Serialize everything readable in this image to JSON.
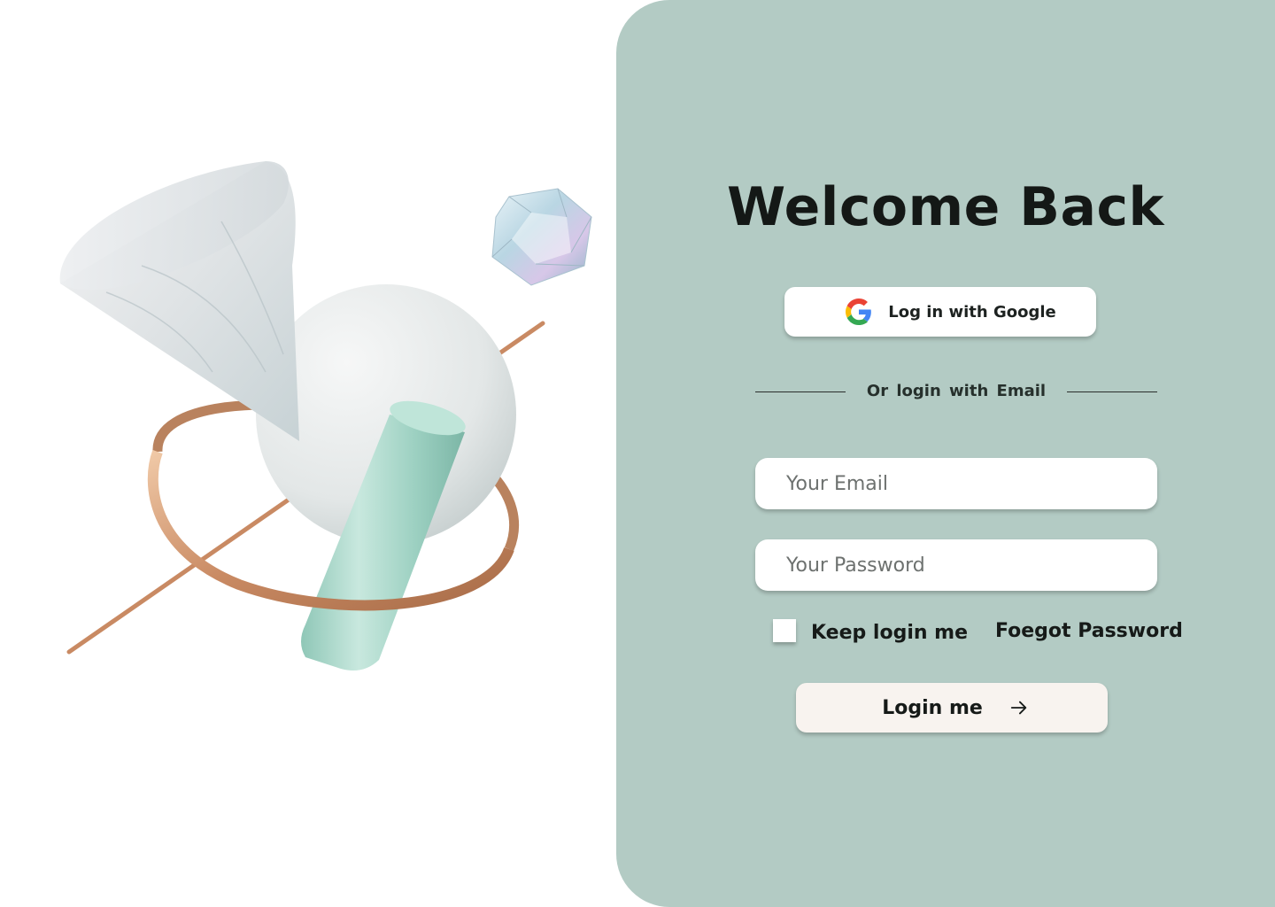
{
  "colors": {
    "panel_bg": "#b3cbc4",
    "primary_button_bg": "#f8f3ef",
    "text_dark": "#141816"
  },
  "art": {
    "shapes": [
      "marble-cone",
      "white-sphere",
      "crystal-gem",
      "copper-ring",
      "copper-rod",
      "mint-cylinder"
    ]
  },
  "login": {
    "title": "Welcome Back",
    "google_button": {
      "label": "Log in with Google",
      "icon": "google-icon"
    },
    "divider_text": "Or  login with  Email",
    "email_field": {
      "placeholder": "Your Email",
      "value": ""
    },
    "password_field": {
      "placeholder": "Your Password",
      "value": ""
    },
    "keep_login": {
      "label": "Keep login me",
      "checked": false
    },
    "forgot_password": "Foegot Password",
    "submit": {
      "label": "Login me",
      "icon": "arrow-right-icon"
    }
  }
}
